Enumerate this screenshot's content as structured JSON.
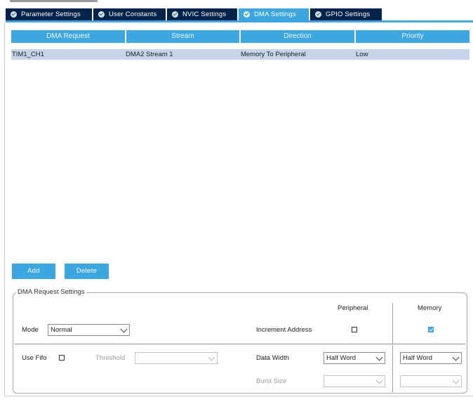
{
  "tabs": [
    {
      "label": "Parameter Settings",
      "active": false,
      "icon": "check-circle-icon"
    },
    {
      "label": "User Constants",
      "active": false,
      "icon": "check-circle-icon"
    },
    {
      "label": "NVIC Settings",
      "active": false,
      "icon": "check-circle-icon"
    },
    {
      "label": "DMA Settings",
      "active": true,
      "icon": "check-circle-icon"
    },
    {
      "label": "GPIO Settings",
      "active": false,
      "icon": "check-circle-icon"
    }
  ],
  "table": {
    "columns": [
      "DMA Request",
      "Stream",
      "Direction",
      "Priority"
    ],
    "rows": [
      {
        "request": "TIM1_CH1",
        "stream": "DMA2 Stream 1",
        "direction": "Memory To Peripheral",
        "priority": "Low",
        "selected": true
      }
    ]
  },
  "buttons": {
    "add": "Add",
    "delete": "Delete"
  },
  "settings": {
    "title": "DMA Request Settings",
    "peripheral_header": "Peripheral",
    "memory_header": "Memory",
    "mode_label": "Mode",
    "mode_value": "Normal",
    "increment_label": "Increment Address",
    "peripheral_increment": false,
    "memory_increment": true,
    "use_fifo_label": "Use Fifo",
    "use_fifo": false,
    "threshold_label": "Threshold",
    "threshold_value": "",
    "data_width_label": "Data Width",
    "peripheral_data_width": "Half Word",
    "memory_data_width": "Half Word",
    "burst_size_label": "Burst Size",
    "peripheral_burst": "",
    "memory_burst": ""
  },
  "colors": {
    "tab_bg": "#03234b",
    "accent": "#3ca6e0",
    "row_selected": "#c5d4e8"
  }
}
